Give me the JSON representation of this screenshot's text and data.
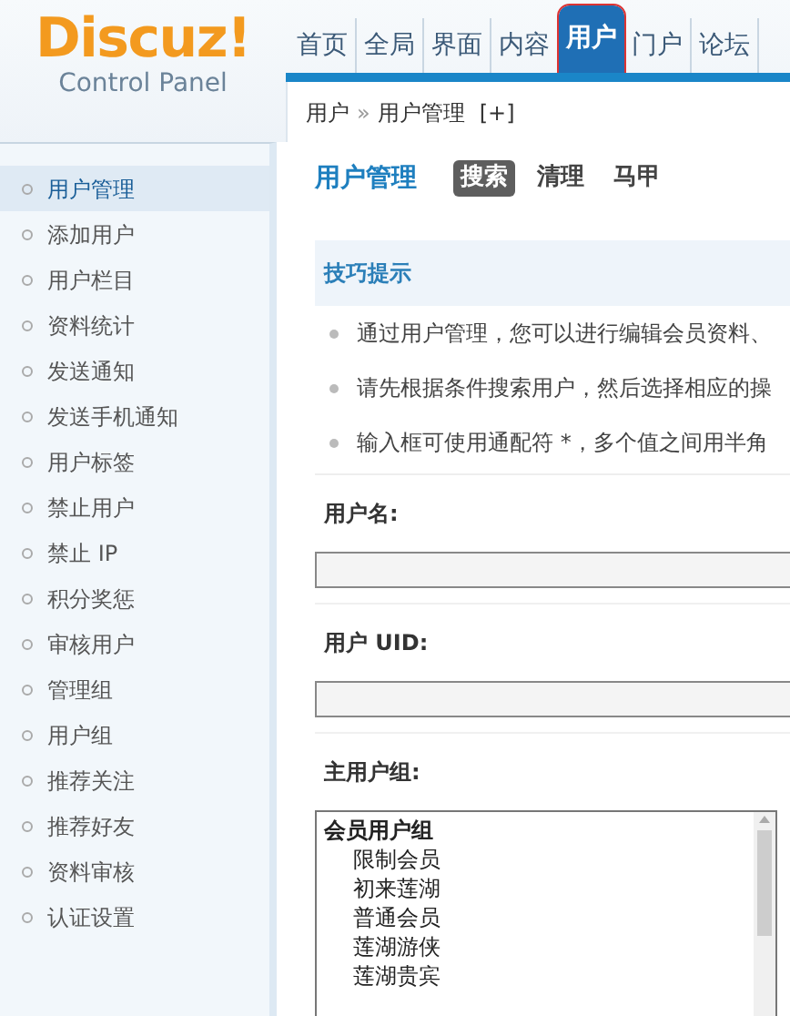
{
  "logo": {
    "title": "Discuz!",
    "subtitle": "Control Panel"
  },
  "nav": [
    {
      "label": "首页",
      "selected": false
    },
    {
      "label": "全局",
      "selected": false
    },
    {
      "label": "界面",
      "selected": false
    },
    {
      "label": "内容",
      "selected": false
    },
    {
      "label": "用户",
      "selected": true
    },
    {
      "label": "门户",
      "selected": false
    },
    {
      "label": "论坛",
      "selected": false
    }
  ],
  "breadcrumb": {
    "section": "用户",
    "separator": "»",
    "page": "用户管理",
    "add": "[+]"
  },
  "sidebar": {
    "items": [
      {
        "label": "用户管理",
        "selected": true
      },
      {
        "label": "添加用户",
        "selected": false
      },
      {
        "label": "用户栏目",
        "selected": false
      },
      {
        "label": "资料统计",
        "selected": false
      },
      {
        "label": "发送通知",
        "selected": false
      },
      {
        "label": "发送手机通知",
        "selected": false
      },
      {
        "label": "用户标签",
        "selected": false
      },
      {
        "label": "禁止用户",
        "selected": false
      },
      {
        "label": "禁止 IP",
        "selected": false
      },
      {
        "label": "积分奖惩",
        "selected": false
      },
      {
        "label": "审核用户",
        "selected": false
      },
      {
        "label": "管理组",
        "selected": false
      },
      {
        "label": "用户组",
        "selected": false
      },
      {
        "label": "推荐关注",
        "selected": false
      },
      {
        "label": "推荐好友",
        "selected": false
      },
      {
        "label": "资料审核",
        "selected": false
      },
      {
        "label": "认证设置",
        "selected": false
      }
    ]
  },
  "page_title": "用户管理",
  "subtabs": [
    {
      "label": "搜索",
      "selected": true
    },
    {
      "label": "清理",
      "selected": false
    },
    {
      "label": "马甲",
      "selected": false
    }
  ],
  "tips": {
    "title": "技巧提示",
    "items": [
      "通过用户管理，您可以进行编辑会员资料、",
      "请先根据条件搜索用户，然后选择相应的操",
      "输入框可使用通配符 *，多个值之间用半角"
    ]
  },
  "form": [
    {
      "kind": "text",
      "label": "用户名:"
    },
    {
      "kind": "text",
      "label": "用户 UID:"
    },
    {
      "kind": "list",
      "label": "主用户组:",
      "options": [
        {
          "label": "会员用户组",
          "kind": "group"
        },
        {
          "label": "限制会员",
          "kind": "option"
        },
        {
          "label": "初来莲湖",
          "kind": "option"
        },
        {
          "label": "普通会员",
          "kind": "option"
        },
        {
          "label": "莲湖游侠",
          "kind": "option"
        },
        {
          "label": "莲湖贵宾",
          "kind": "option"
        }
      ]
    }
  ]
}
